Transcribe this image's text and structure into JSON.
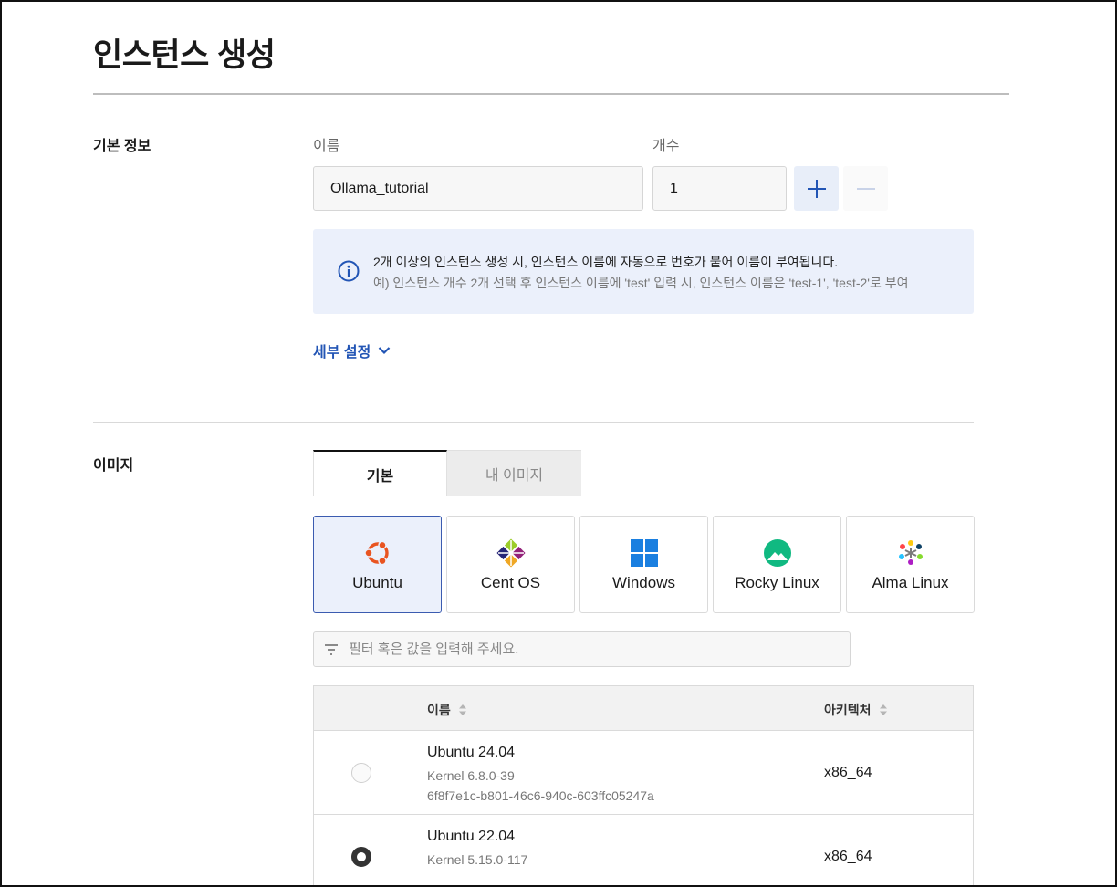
{
  "page": {
    "title": "인스턴스 생성"
  },
  "basic_info": {
    "section_label": "기본 정보",
    "name_label": "이름",
    "name_value": "Ollama_tutorial",
    "count_label": "개수",
    "count_value": "1",
    "info_line1": "2개 이상의 인스턴스 생성 시, 인스턴스 이름에 자동으로 번호가 붙어 이름이 부여됩니다.",
    "info_line2": "예) 인스턴스 개수 2개 선택 후 인스턴스 이름에 'test' 입력 시, 인스턴스 이름은 'test-1', 'test-2'로 부여",
    "detail_toggle": "세부 설정"
  },
  "image": {
    "section_label": "이미지",
    "tabs": [
      {
        "label": "기본",
        "active": true
      },
      {
        "label": "내 이미지",
        "active": false
      }
    ],
    "os_options": [
      {
        "label": "Ubuntu",
        "icon": "ubuntu-icon",
        "selected": true
      },
      {
        "label": "Cent OS",
        "icon": "centos-icon",
        "selected": false
      },
      {
        "label": "Windows",
        "icon": "windows-icon",
        "selected": false
      },
      {
        "label": "Rocky Linux",
        "icon": "rocky-linux-icon",
        "selected": false
      },
      {
        "label": "Alma Linux",
        "icon": "alma-linux-icon",
        "selected": false
      }
    ],
    "filter_placeholder": "필터 혹은 값을 입력해 주세요.",
    "table": {
      "columns": [
        "이름",
        "아키텍처"
      ],
      "rows": [
        {
          "name": "Ubuntu 24.04",
          "kernel": "Kernel 6.8.0-39",
          "id": "6f8f7e1c-b801-46c6-940c-603ffc05247a",
          "arch": "x86_64",
          "selected": false
        },
        {
          "name": "Ubuntu 22.04",
          "kernel": "Kernel 5.15.0-117",
          "id": "",
          "arch": "x86_64",
          "selected": true
        }
      ]
    }
  },
  "colors": {
    "accent": "#2255b5",
    "selected_bg": "#ebf0fb",
    "ubuntu": "#e95420",
    "rocky": "#10b981"
  }
}
